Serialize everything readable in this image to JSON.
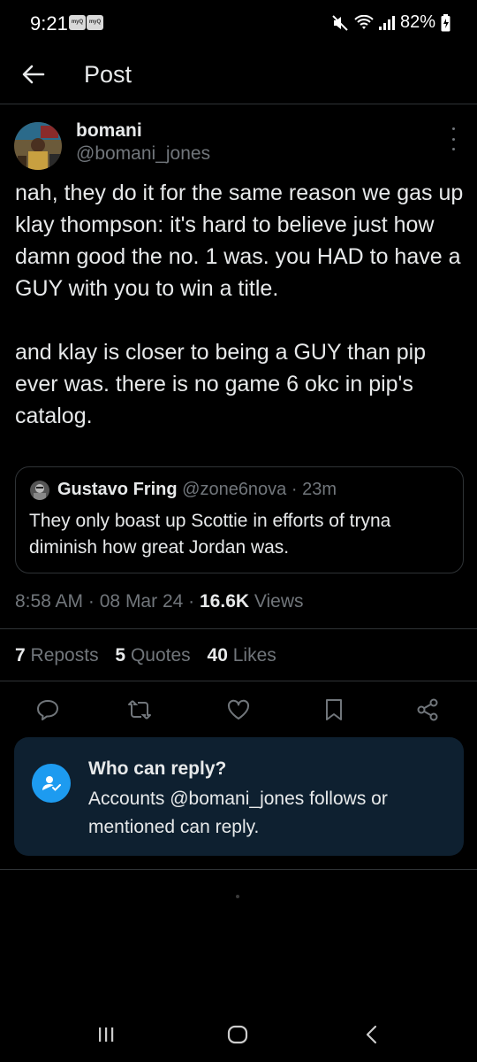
{
  "status_bar": {
    "time": "9:21",
    "notif_icons": [
      "myQ",
      "myQ"
    ],
    "battery": "82%"
  },
  "header": {
    "title": "Post"
  },
  "tweet": {
    "author_name": "bomani",
    "author_handle": "@bomani_jones",
    "text": "nah, they do it for the same reason we gas up klay thompson: it's hard to believe just how damn good the no. 1 was. you HAD to have a GUY with you to win a title.\n\nand klay is closer to being a GUY than pip ever was. there is no game 6 okc in pip's catalog.",
    "quote": {
      "name": "Gustavo Fring",
      "handle": "@zone6nova",
      "separator": "·",
      "time": "23m",
      "text": "They only boast up Scottie in efforts of tryna diminish how great Jordan was."
    },
    "meta": {
      "time": "8:58 AM",
      "sep1": "·",
      "date": "08 Mar 24",
      "sep2": "·",
      "views_count": "16.6K",
      "views_label": "Views"
    },
    "stats": {
      "reposts_count": "7",
      "reposts_label": "Reposts",
      "quotes_count": "5",
      "quotes_label": "Quotes",
      "likes_count": "40",
      "likes_label": "Likes"
    },
    "actions": [
      "reply-icon",
      "repost-icon",
      "like-icon",
      "bookmark-icon",
      "share-icon"
    ]
  },
  "reply_restriction": {
    "title": "Who can reply?",
    "description": "Accounts @bomani_jones follows or mentioned can reply."
  },
  "colors": {
    "background": "#000000",
    "text": "#e7e9ea",
    "secondary": "#71767b",
    "accent": "#1d9bf0",
    "card": "#0e2030",
    "border": "#2f3336"
  }
}
